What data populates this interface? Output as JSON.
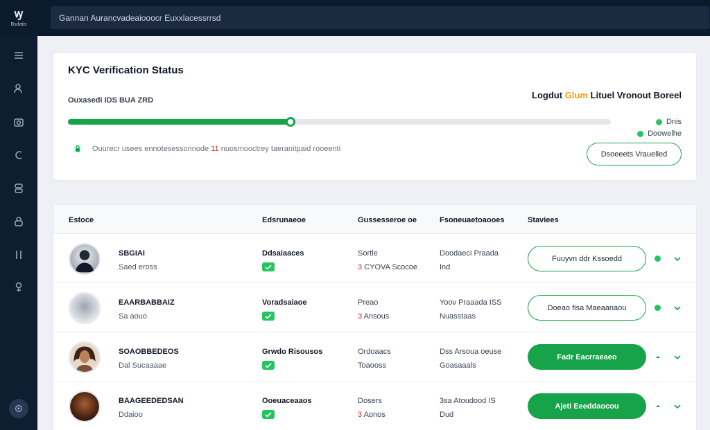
{
  "brand": {
    "mark": "ꝡ",
    "name": "Bsdatis"
  },
  "search": {
    "placeholder": "Gannan Aurancvadeaiooocr Euxxlacessrrsd"
  },
  "sidebar": {
    "icons": [
      "menu-icon",
      "user-check-icon",
      "camera-icon",
      "c-icon",
      "layers-icon",
      "lock-icon",
      "document-icon",
      "location-icon"
    ],
    "footer_icon": "settings-icon"
  },
  "status_card": {
    "title": "KYC Verification Status",
    "progress_label": "Ouxasedi IDS BUA ZRD",
    "progress_fraction": 0.41,
    "legend_title_before": "Logdut ",
    "legend_title_accent": "Glum",
    "legend_title_after": " Lituel Vronout Boreel",
    "legend": [
      {
        "label": "Dnis",
        "color": "#22c55e"
      },
      {
        "label": "Doowelhe",
        "color": "#22c55e"
      }
    ],
    "note_before": "Ouurecr usees ennotesessonnode ",
    "note_highlight": "11",
    "note_after": " nuosmooctrey taeranitpaid rooeenti",
    "action_label": "Dsoeeets Vrauelled"
  },
  "table": {
    "columns": [
      "Estoce",
      "Edsrunaeoe",
      "Gussesseroe oe",
      "Fsoneuaetoaooes",
      "Staviees"
    ],
    "rows": [
      {
        "name": "SBGIAI",
        "sub": "Saed eross",
        "docs": "Ddsaiaaces",
        "c3a": "Sortle",
        "c3b_hl": "3",
        "c3b": " CYOVA Scocoe",
        "c4a": "Doodaeci Praada",
        "c4b": "Ind",
        "action": "Fuuyvn ddr Kssoedd",
        "style": "outline",
        "indicator": "dot"
      },
      {
        "name": "EAARBABBAIZ",
        "sub": "Sa aouo",
        "docs": "Voradsaiaoe",
        "c3a": "Preao",
        "c3b_hl": "3",
        "c3b": " Ansous",
        "c4a": "Yoov Praaada ISS",
        "c4b": "Nuasstaas",
        "action": "Doeao fisa Maeaanaou",
        "style": "outline",
        "indicator": "dot"
      },
      {
        "name": "SOAOBBEDEOS",
        "sub": "Dal Sucaaaae",
        "docs": "Grwdo Risousos",
        "c3a": "Ordoaacs",
        "c3b_hl": "",
        "c3b": "Toaooss",
        "c4a": "Dss Arsoua oeuse",
        "c4b": "Goasaaals",
        "action": "Fadr Eacrraeaeo",
        "style": "solid",
        "indicator": "caret"
      },
      {
        "name": "BAAGEEDEDSAN",
        "sub": "Ddaioo",
        "docs": "Ooeuaceaaos",
        "c3a": "Dosers",
        "c3b_hl": "3",
        "c3b": " Aonos",
        "c4a": "3sa Atoudood IS",
        "c4b": "Dud",
        "action": "Ajeti Eeeddaocou",
        "style": "solid",
        "indicator": "caret"
      }
    ]
  }
}
